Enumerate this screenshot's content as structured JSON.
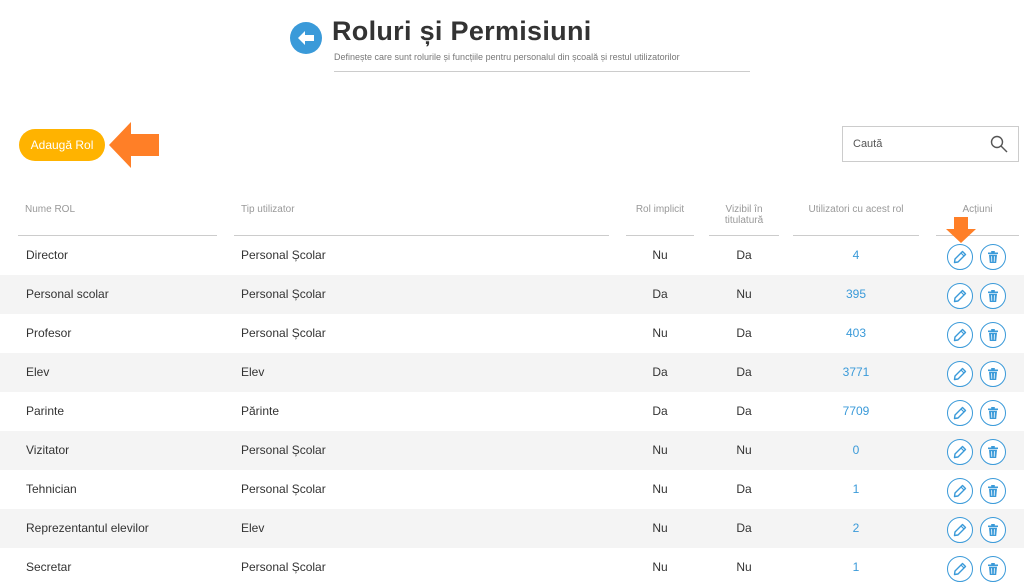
{
  "header": {
    "title": "Roluri și Permisiuni",
    "subtitle": "Definește care sunt rolurile și funcțiile pentru personalul din școală și restul utilizatorilor",
    "back_icon": "back-arrow-icon"
  },
  "toolbar": {
    "add_label": "Adaugă Rol",
    "search_placeholder": "Caută"
  },
  "columns": {
    "name": "Nume ROL",
    "type": "Tip utilizator",
    "default": "Rol implicit",
    "visible_line1": "Vizibil în",
    "visible_line2": "titulatură",
    "users": "Utilizatori cu acest rol",
    "actions": "Acțiuni"
  },
  "rows": [
    {
      "name": "Director",
      "type": "Personal Școlar",
      "default": "Nu",
      "visible": "Da",
      "users": "4"
    },
    {
      "name": "Personal scolar",
      "type": "Personal Școlar",
      "default": "Da",
      "visible": "Nu",
      "users": "395"
    },
    {
      "name": "Profesor",
      "type": "Personal Școlar",
      "default": "Nu",
      "visible": "Da",
      "users": "403"
    },
    {
      "name": "Elev",
      "type": "Elev",
      "default": "Da",
      "visible": "Da",
      "users": "3771"
    },
    {
      "name": "Parinte",
      "type": "Părinte",
      "default": "Da",
      "visible": "Da",
      "users": "7709"
    },
    {
      "name": "Vizitator",
      "type": "Personal Școlar",
      "default": "Nu",
      "visible": "Nu",
      "users": "0"
    },
    {
      "name": "Tehnician",
      "type": "Personal Școlar",
      "default": "Nu",
      "visible": "Da",
      "users": "1"
    },
    {
      "name": "Reprezentantul elevilor",
      "type": "Elev",
      "default": "Nu",
      "visible": "Da",
      "users": "2"
    },
    {
      "name": "Secretar",
      "type": "Personal Școlar",
      "default": "Nu",
      "visible": "Nu",
      "users": "1"
    }
  ],
  "colors": {
    "accent": "#3a9ad9",
    "add_button": "#ffb300",
    "annotation_arrow": "#ff7f27"
  },
  "icons": {
    "edit": "pencil-icon",
    "delete": "trash-icon",
    "search": "search-icon"
  }
}
